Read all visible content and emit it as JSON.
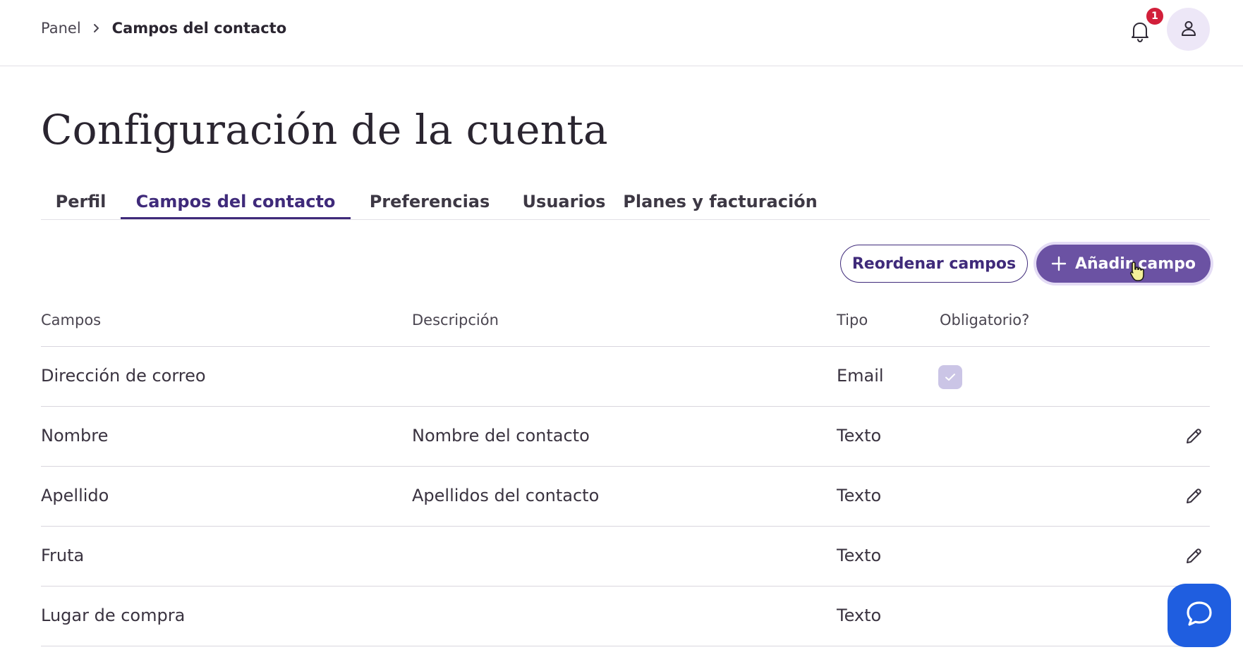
{
  "breadcrumb": {
    "root": "Panel",
    "current": "Campos del contacto"
  },
  "notifications": {
    "count": "1"
  },
  "page": {
    "title": "Configuración de la cuenta"
  },
  "tabs": [
    {
      "label": "Perfil",
      "active": false
    },
    {
      "label": "Campos del contacto",
      "active": true
    },
    {
      "label": "Preferencias",
      "active": false
    },
    {
      "label": "Usuarios",
      "active": false
    },
    {
      "label": "Planes y facturación",
      "active": false
    }
  ],
  "actions": {
    "reorder_label": "Reordenar campos",
    "add_label": "Añadir campo"
  },
  "table": {
    "headers": [
      "Campos",
      "Descripción",
      "Tipo",
      "Obligatorio?"
    ],
    "rows": [
      {
        "field": "Dirección de correo",
        "description": "",
        "type": "Email",
        "required": true,
        "editable": false
      },
      {
        "field": "Nombre",
        "description": "Nombre del contacto",
        "type": "Texto",
        "required": false,
        "editable": true
      },
      {
        "field": "Apellido",
        "description": "Apellidos del contacto",
        "type": "Texto",
        "required": false,
        "editable": true
      },
      {
        "field": "Fruta",
        "description": "",
        "type": "Texto",
        "required": false,
        "editable": true
      },
      {
        "field": "Lugar de compra",
        "description": "",
        "type": "Texto",
        "required": false,
        "editable": false
      }
    ]
  },
  "colors": {
    "accent": "#3f2a7a",
    "primary_button": "#6b52a3",
    "badge": "#d21f3a",
    "chat": "#1f5ee0",
    "checkbox": "#cbc5e6"
  },
  "icons": [
    "chevron-right-icon",
    "bell-icon",
    "user-icon",
    "plus-icon",
    "check-icon",
    "pencil-icon",
    "chat-icon",
    "pointer-cursor-icon"
  ]
}
